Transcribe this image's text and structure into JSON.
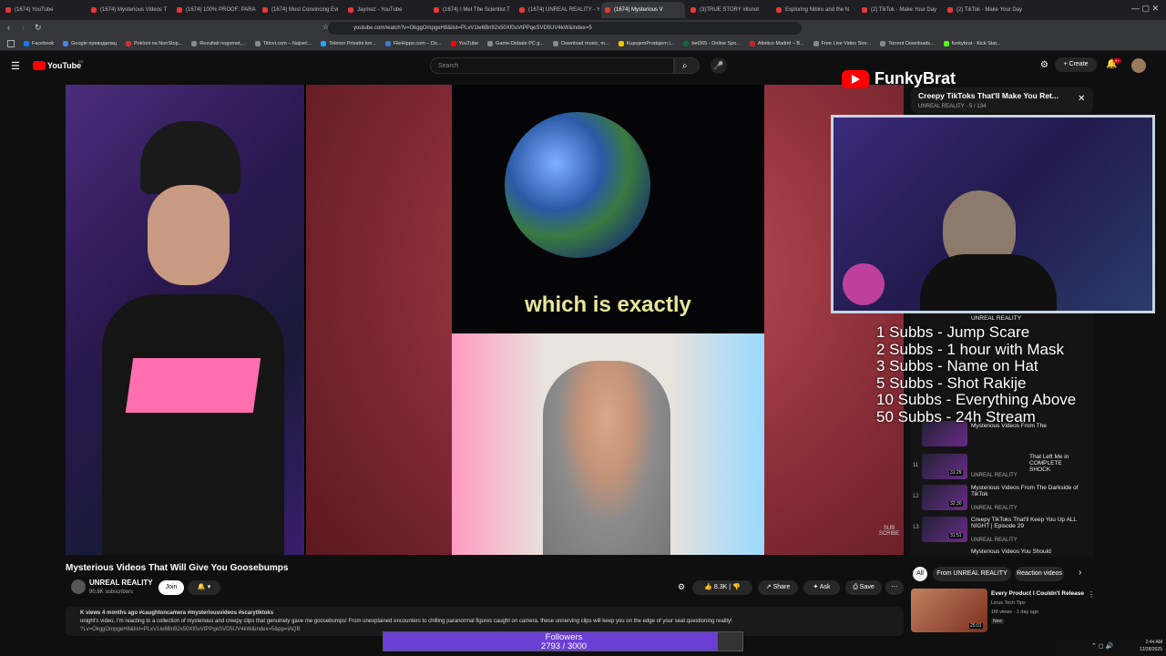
{
  "browser": {
    "tabs": [
      {
        "label": "(1674) YouTube"
      },
      {
        "label": "(1674) Mysterious Videos T"
      },
      {
        "label": "(1674) 100% PROOF: PARA"
      },
      {
        "label": "(1674) Most Convincing Evi"
      },
      {
        "label": "Jaymez - YouTube"
      },
      {
        "label": "(1674) I Met The Scientist T"
      },
      {
        "label": "(1674) UNREAL REALITY - Y"
      },
      {
        "label": "(1674) Mysterious V",
        "active": true
      },
      {
        "label": "(3)TRUE STORY #itsnot"
      },
      {
        "label": "Exploring Nibiru and the N"
      },
      {
        "label": "(2) TikTok - Make Your Day"
      },
      {
        "label": "(2) TikTok - Make Your Day"
      }
    ],
    "url": "youtube.com/watch?v=OkggOmpgeH8&list=PLxV1Ie6Bn92x50Xf0uVtPPqeSVD5UV4kW&index=5",
    "bookmarks": [
      {
        "label": "Facebook",
        "color": "#1877f2"
      },
      {
        "label": "Google преводилац",
        "color": "#4285f4"
      },
      {
        "label": "Pokloni na NonStop...",
        "color": "#d32f2f"
      },
      {
        "label": "Rezultati nogomet,...",
        "color": "#888888"
      },
      {
        "label": "Titlovi.com – Najveć...",
        "color": "#888888"
      },
      {
        "label": "Telenor Privatni kor...",
        "color": "#19aaf8"
      },
      {
        "label": "FileHippo.com – Do...",
        "color": "#3a7bd5"
      },
      {
        "label": "YouTube",
        "color": "#ff0000"
      },
      {
        "label": "Game-Debate PC g...",
        "color": "#888888"
      },
      {
        "label": "Download music, m...",
        "color": "#888888"
      },
      {
        "label": "KupujemProdajem |...",
        "color": "#f5c400"
      },
      {
        "label": "bet365 - Online Spo...",
        "color": "#0b6b3a"
      },
      {
        "label": "Atletico Madrid – B...",
        "color": "#c62828"
      },
      {
        "label": "Free Live Video Stre...",
        "color": "#888888"
      },
      {
        "label": "Torrent Downloads...",
        "color": "#888888"
      },
      {
        "label": "funkybrat - Kick Stat...",
        "color": "#53fc18"
      }
    ]
  },
  "youtube": {
    "logo": "YouTube",
    "region": "RS",
    "search_placeholder": "Search",
    "create_label": "Create",
    "notif_count": "9+"
  },
  "video": {
    "caption": "which is exactly",
    "watermark": "SUB SCRIBE",
    "title": "Mysterious Videos That Will Give You Goosebumps",
    "channel": "UNREAL REALITY",
    "subscribers": "90.8K subscribers",
    "join_label": "Join",
    "likes": "8.3K",
    "share_label": "Share",
    "ask_label": "Ask",
    "save_label": "Save",
    "desc_meta": "K views  4 months ago  #caughtoncamera #mysteriousvideos #scarytiktoks",
    "desc_line1": "onight's video, I'm reacting to a collection of mysterious and creepy clips that genuinely gave me goosebumps! From unexplained encounters to chilling paranormal figures caught on camera, these unnerving clips will keep you on the edge of your seat questioning reality!",
    "desc_line2": "?Lv=OkggOmpgeH8&list=PLxV1Ie6Bn92x50Xf0uVtPPqeSVD5UV4kW&index=5&pp=iAQB"
  },
  "overlay": {
    "brand": "FunkyBrat",
    "playlist_title": "Creepy TikToks That'll Make You Ret...",
    "playlist_meta": "UNREAL REALITY  ·  5 / 134",
    "subgoals": [
      "1 Subbs - Jump Scare",
      "2 Subbs - 1 hour with Mask",
      "3 Subbs - Name on Hat",
      "5 Subbs - Shot Rakije",
      "10 Subbs - Everything Above",
      "50 Subbs - 24h Stream"
    ],
    "followers_label": "Followers",
    "followers_text": "2793 / 3000",
    "followers_current": 2793,
    "followers_goal": 3000
  },
  "sidebar": {
    "playlist": [
      {
        "num": "",
        "title": "Mysterious Videos From The",
        "channel": "UNREAL REALITY",
        "time": ""
      },
      {
        "num": "11",
        "title": "That Left Me in COMPLETE SHOCK",
        "channel": "UNREAL REALITY",
        "time": "31:29"
      },
      {
        "num": "12",
        "title": "Mysterious Videos From The Darkside of TikTok",
        "channel": "UNREAL REALITY",
        "time": "32:30"
      },
      {
        "num": "13",
        "title": "Creepy TikToks That'll Keep You Up ALL NIGHT | Episode 29",
        "channel": "UNREAL REALITY",
        "time": "31:51"
      },
      {
        "num": "",
        "title": "Mysterious Videos You Should",
        "channel": "",
        "time": ""
      }
    ],
    "chips": [
      "All",
      "From UNREAL REALITY",
      "Reaction videos"
    ],
    "rec": {
      "title": "Every Product I Couldn't Release",
      "channel": "Linus Tech Tips",
      "meta": "1M views · 1 day ago",
      "badge": "New",
      "time": "25:01"
    }
  },
  "taskbar": {
    "time": "2:44 AM",
    "date": "12/28/2025"
  }
}
